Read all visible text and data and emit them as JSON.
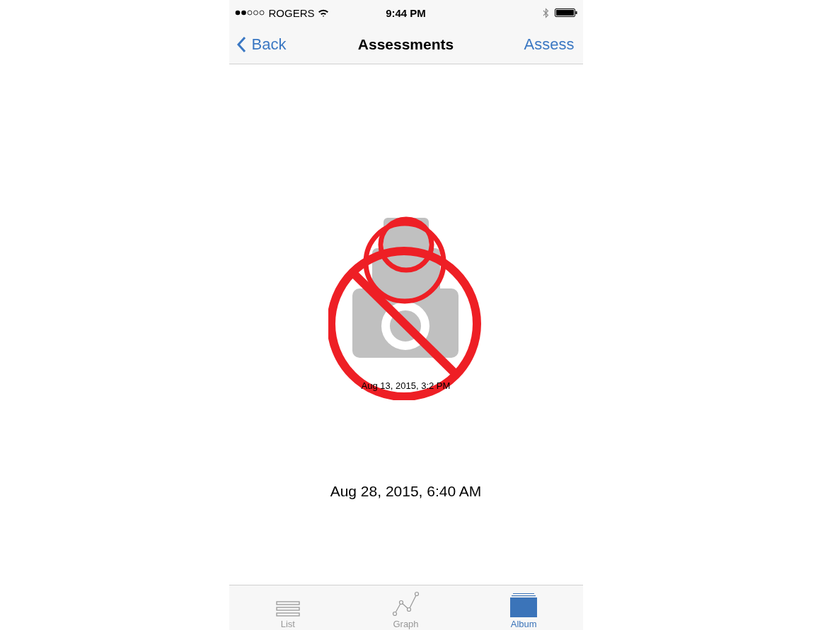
{
  "status_bar": {
    "carrier": "ROGERS",
    "time": "9:44 PM"
  },
  "nav_bar": {
    "back": "Back",
    "title": "Assessments",
    "action": "Assess"
  },
  "album": {
    "photo_caption": "Aug 13, 2015, 3:2 PM",
    "date": "Aug 28, 2015, 6:40 AM"
  },
  "tabs": [
    {
      "label": "List",
      "kind": "list",
      "selected": false
    },
    {
      "label": "Graph",
      "kind": "graph",
      "selected": false
    },
    {
      "label": "Album",
      "kind": "album",
      "selected": true
    }
  ]
}
